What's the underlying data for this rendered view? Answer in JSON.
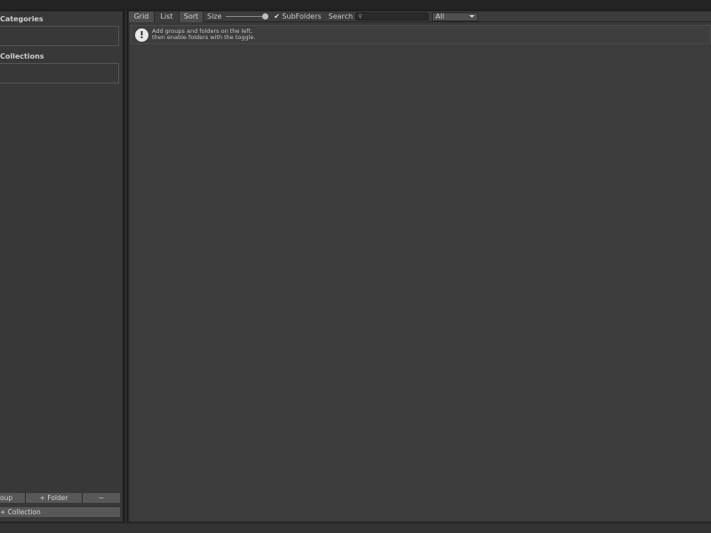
{
  "left_panel": {
    "categories_title": "Categories",
    "collections_title": "Collections",
    "buttons": {
      "group": "oup",
      "folder": "+ Folder",
      "remove": "−",
      "collection": "+ Collection"
    }
  },
  "toolbar": {
    "grid": "Grid",
    "list": "List",
    "sort": "Sort",
    "size_label": "Size",
    "size_value": 1.0,
    "subfolders_label": "SubFolders",
    "subfolders_checked": true,
    "search_label": "Search",
    "search_value": "",
    "filter_selected": "All"
  },
  "info": {
    "line1": "Add groups and folders on the left,",
    "line2": "then enable folders with the toggle."
  },
  "icons": {
    "info": "exclamation-bubble-icon",
    "search": "search-icon",
    "check": "check-icon",
    "dropdown": "chevron-down-icon"
  }
}
